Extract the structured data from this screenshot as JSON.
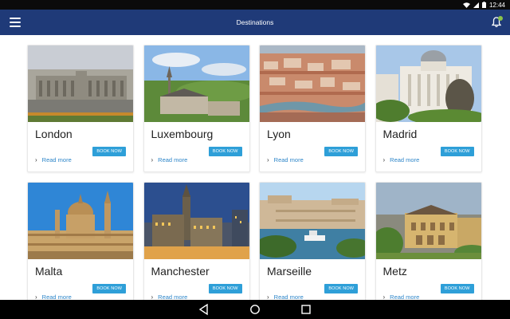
{
  "status": {
    "time": "12:44"
  },
  "app_bar": {
    "title": "Destinations"
  },
  "cards": [
    {
      "name": "London",
      "book": "BOOK NOW",
      "more": "Read more"
    },
    {
      "name": "Luxembourg",
      "book": "BOOK NOW",
      "more": "Read more"
    },
    {
      "name": "Lyon",
      "book": "BOOK NOW",
      "more": "Read more"
    },
    {
      "name": "Madrid",
      "book": "BOOK NOW",
      "more": "Read more"
    },
    {
      "name": "Malta",
      "book": "BOOK NOW",
      "more": "Read more"
    },
    {
      "name": "Manchester",
      "book": "BOOK NOW",
      "more": "Read more"
    },
    {
      "name": "Marseille",
      "book": "BOOK NOW",
      "more": "Read more"
    },
    {
      "name": "Metz",
      "book": "BOOK NOW",
      "more": "Read more"
    }
  ],
  "colors": {
    "app_bar": "#1f3a78",
    "button": "#2e9fd8",
    "link": "#2e86c9",
    "badge": "#8bc34a"
  }
}
